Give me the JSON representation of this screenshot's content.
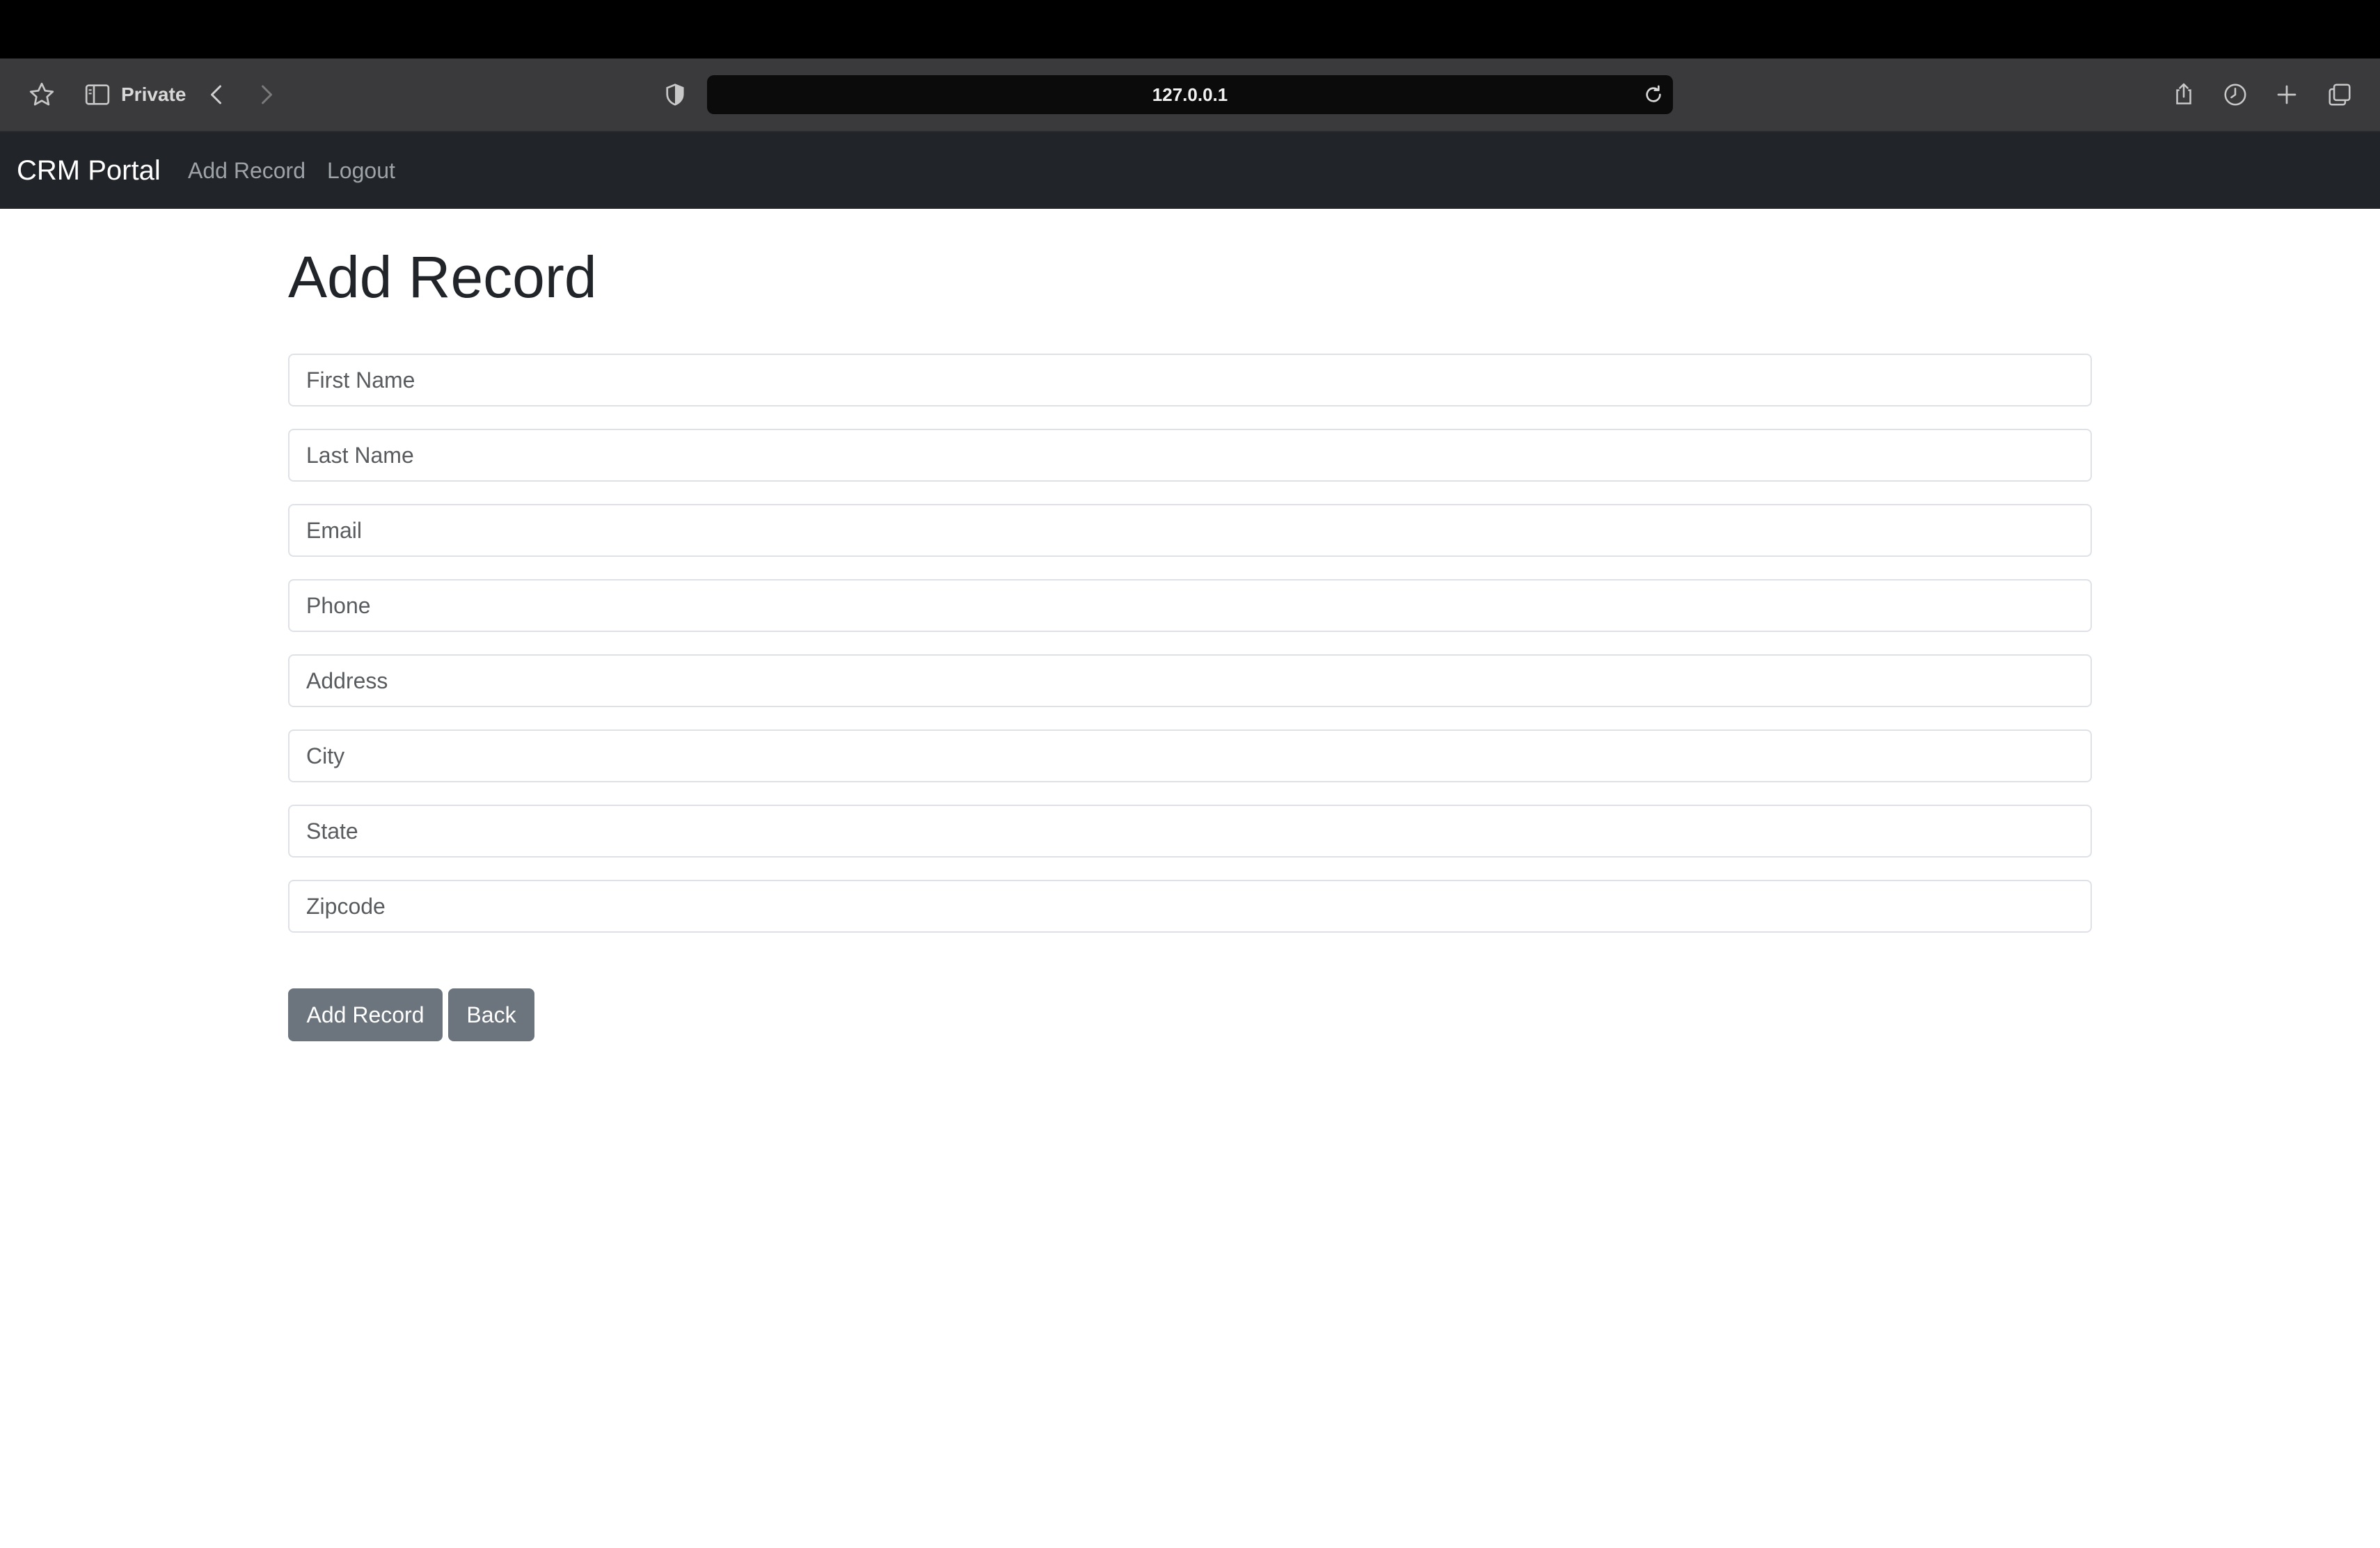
{
  "browser": {
    "private_label": "Private",
    "url": "127.0.0.1"
  },
  "navbar": {
    "brand": "CRM Portal",
    "links": [
      {
        "label": "Add Record"
      },
      {
        "label": "Logout"
      }
    ]
  },
  "page": {
    "title": "Add Record"
  },
  "form": {
    "fields": [
      {
        "placeholder": "First Name",
        "value": ""
      },
      {
        "placeholder": "Last Name",
        "value": ""
      },
      {
        "placeholder": "Email",
        "value": ""
      },
      {
        "placeholder": "Phone",
        "value": ""
      },
      {
        "placeholder": "Address",
        "value": ""
      },
      {
        "placeholder": "City",
        "value": ""
      },
      {
        "placeholder": "State",
        "value": ""
      },
      {
        "placeholder": "Zipcode",
        "value": ""
      }
    ],
    "submit_label": "Add Record",
    "back_label": "Back"
  },
  "colors": {
    "navbar_bg": "#212529",
    "button_bg": "#6c757d"
  },
  "icons": [
    "star-icon",
    "sidebar-icon",
    "back-arrow-icon",
    "forward-arrow-icon",
    "privacy-shield-icon",
    "reload-icon",
    "share-icon",
    "history-icon",
    "new-tab-icon",
    "tab-overview-icon"
  ]
}
